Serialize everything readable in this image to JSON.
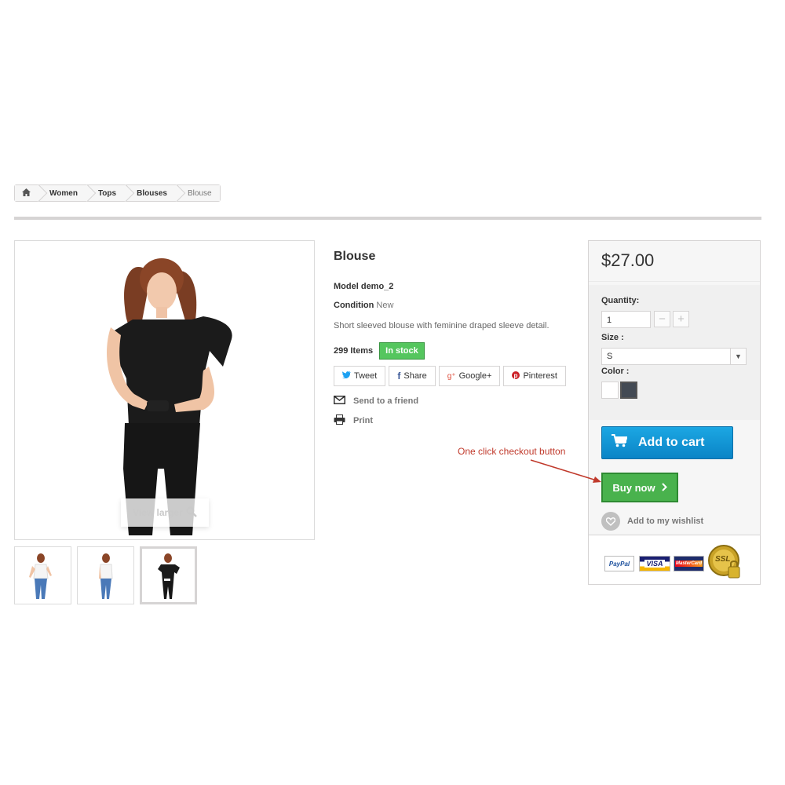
{
  "breadcrumb": {
    "items": [
      "Women",
      "Tops",
      "Blouses"
    ],
    "current": "Blouse"
  },
  "gallery": {
    "view_larger": "View larger"
  },
  "product": {
    "title": "Blouse",
    "model_label": "Model",
    "model_value": "demo_2",
    "condition_label": "Condition",
    "condition_value": "New",
    "description": "Short sleeved blouse with feminine draped sleeve detail.",
    "items_count": "299 Items",
    "stock_badge": "In stock"
  },
  "social": {
    "tweet": "Tweet",
    "share": "Share",
    "google": "Google+",
    "pinterest": "Pinterest"
  },
  "actions": {
    "send_to_friend": "Send to a friend",
    "print": "Print"
  },
  "buy_box": {
    "price": "$27.00",
    "quantity_label": "Quantity:",
    "quantity_value": "1",
    "size_label": "Size :",
    "size_value": "S",
    "color_label": "Color :",
    "colors": [
      "#ffffff",
      "#434a54"
    ],
    "add_to_cart": "Add to cart",
    "buy_now": "Buy now",
    "wishlist": "Add to my wishlist",
    "payment_cards": [
      "PayPal",
      "VISA",
      "MasterCard",
      "SSL"
    ]
  },
  "annotation": {
    "callout": "One click checkout button"
  },
  "colors": {
    "accent_blue": "#0a84c6",
    "buy_green": "#49b24d",
    "stock_green": "#55c65e",
    "callout_red": "#c0392b"
  }
}
